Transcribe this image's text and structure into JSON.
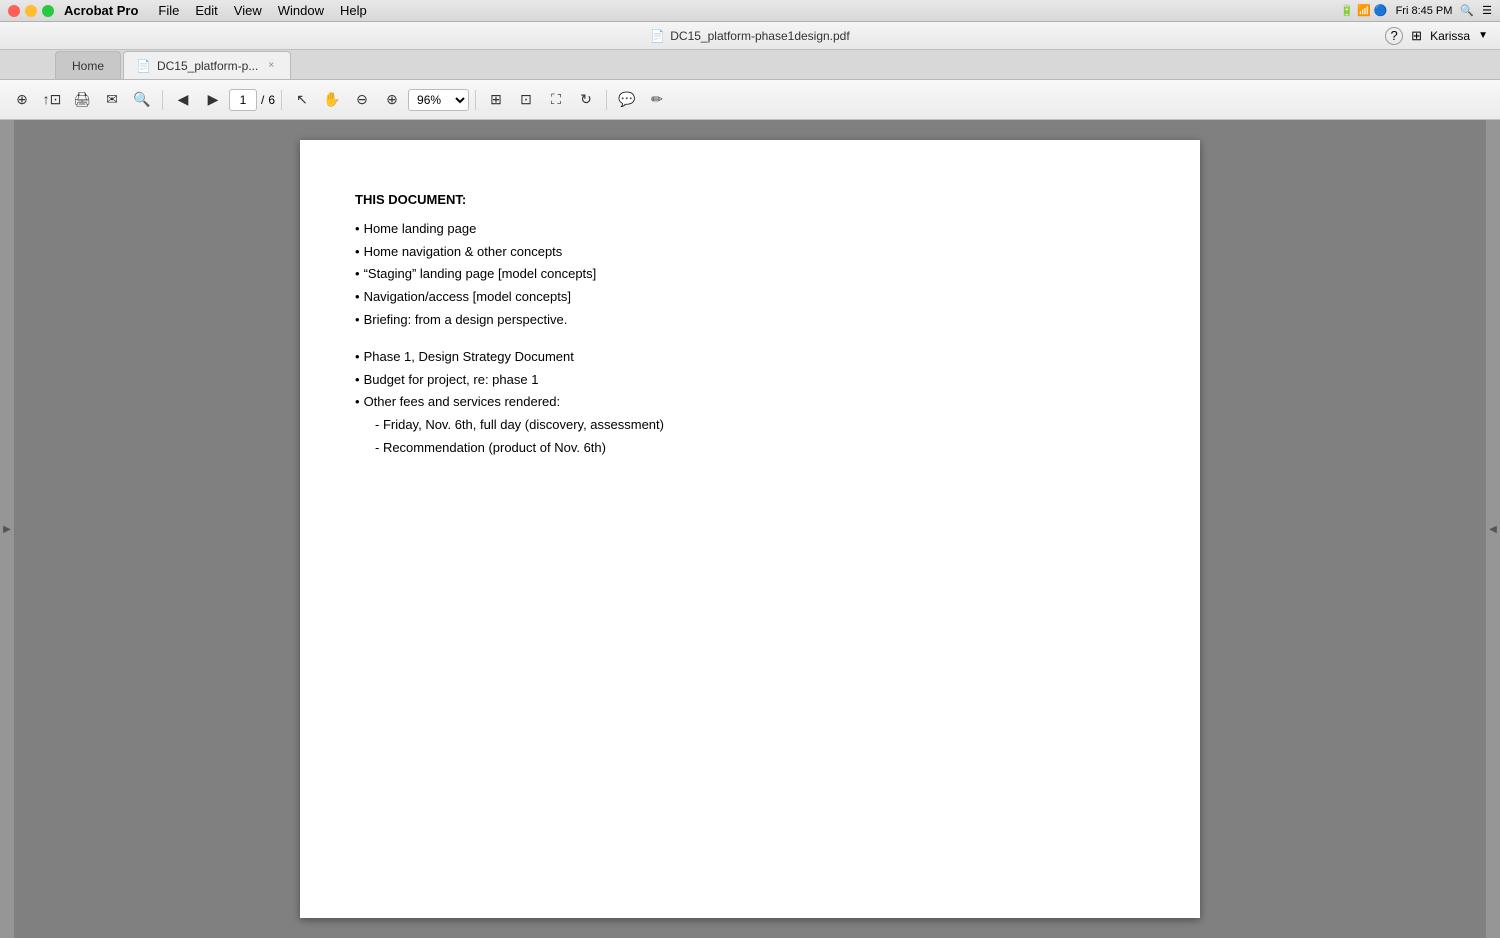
{
  "menubar": {
    "app_name": "Acrobat Pro",
    "menus": [
      "File",
      "Edit",
      "View",
      "Window",
      "Help"
    ],
    "system_icons": "🔍 ≡",
    "time": "Fri 8:45 PM"
  },
  "titlebar": {
    "icon": "📄",
    "title": "DC15_platform-phase1design.pdf",
    "user": "Karissa",
    "help_label": "?",
    "organize_label": "⊞"
  },
  "tabs": {
    "home_label": "Home",
    "doc_label": "DC15_platform-p...",
    "close_label": "×"
  },
  "toolbar": {
    "page_current": "1",
    "page_sep": "/",
    "page_total": "6",
    "zoom_value": "96%"
  },
  "document": {
    "heading": "THIS DOCUMENT:",
    "bullets": [
      "Home landing page",
      "Home navigation & other concepts",
      "“Staging” landing page [model concepts]",
      "Navigation/access [model concepts]",
      "Briefing: from a design perspective."
    ],
    "bullets2": [
      "Phase 1, Design Strategy Document",
      "Budget for project, re: phase 1",
      "Other fees and services rendered:"
    ],
    "sub_bullets": [
      "- Friday, Nov. 6th, full day (discovery, assessment)",
      "- Recommendation (product of Nov. 6th)"
    ]
  }
}
